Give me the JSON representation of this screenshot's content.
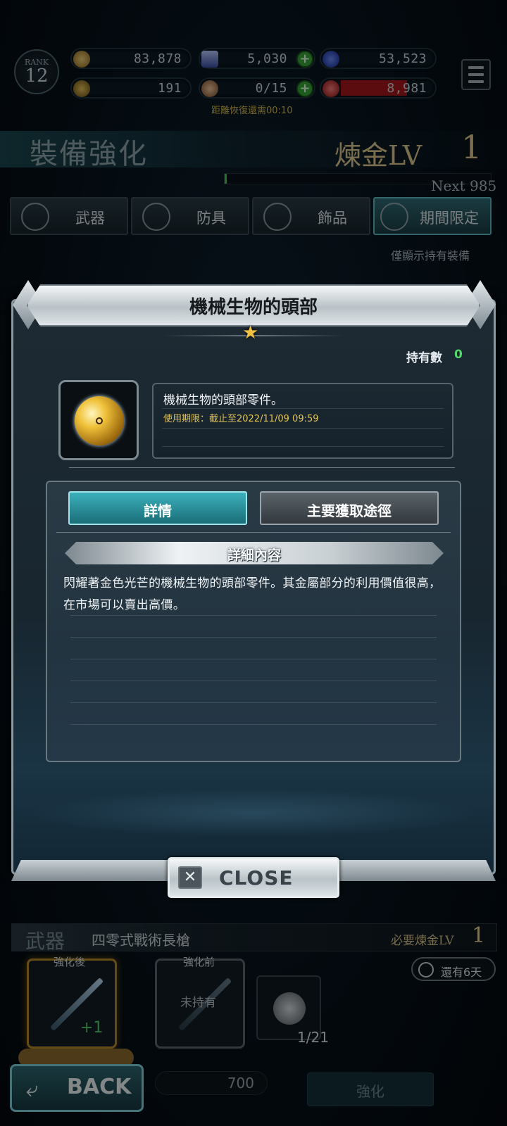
{
  "header": {
    "rank_label": "RANK",
    "rank_value": "12",
    "resources": {
      "gold": "83,878",
      "crystal": "5,030",
      "blue": "53,523",
      "trophy": "191",
      "ore": "0/15",
      "red": "8,981"
    },
    "recover_text": "距離恢復還需00:10"
  },
  "screen": {
    "title": "裝備強化",
    "alchemy_label": "煉金LV",
    "alchemy_level": "1",
    "next_label": "Next 985",
    "categories": [
      {
        "label": "武器",
        "icon": "sword-icon"
      },
      {
        "label": "防具",
        "icon": "armor-icon"
      },
      {
        "label": "飾品",
        "icon": "ring-icon"
      },
      {
        "label": "期間限定",
        "icon": "clock-icon"
      }
    ],
    "owned_only": "僅顯示持有裝備"
  },
  "modal": {
    "title": "機械生物的頭部",
    "owned_label": "持有數",
    "owned_count": "0",
    "item_short_desc": "機械生物的頭部零件。",
    "expiry": "使用期限：截止至2022/11/09 09:59",
    "tab_detail": "詳情",
    "tab_route": "主要獲取途徑",
    "detail_header": "詳細內容",
    "detail_body": "閃耀著金色光芒的機械生物的頭部零件。其金屬部分的利用價值很高，在市場可以賣出高價。",
    "close_label": "CLOSE"
  },
  "bottom": {
    "weapon_category": "武器",
    "weapon_name": "四零式戰術長槍",
    "required_label": "必要煉金LV",
    "required_value": "1",
    "days_left": "還有6天",
    "after_label": "強化後",
    "before_label": "強化前",
    "plus_value": "+1",
    "unowned_label": "未持有",
    "material_count": "1/21",
    "back_label": "BACK",
    "cost_value": "700",
    "enhance_label": "強化"
  },
  "colors": {
    "accent_teal": "#3bb0bb",
    "owned_green": "#53d86a",
    "expiry_gold": "#e3c452",
    "star_gold": "#f1c142"
  }
}
